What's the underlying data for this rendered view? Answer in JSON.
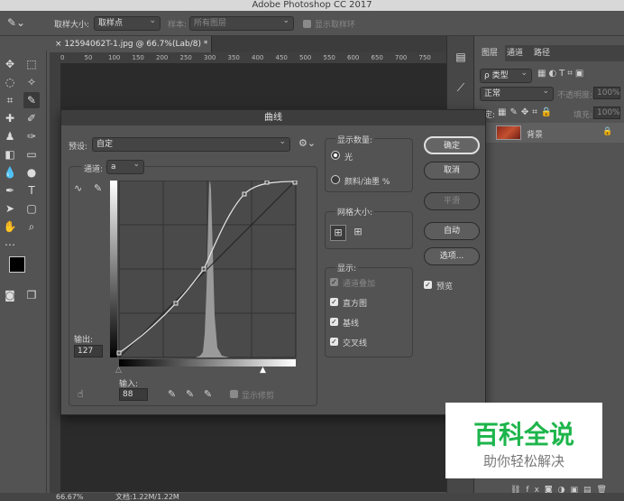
{
  "app": {
    "title": "Adobe Photoshop CC 2017"
  },
  "options_bar": {
    "sample_size_label": "取样大小:",
    "sample_size_value": "取样点",
    "sample_label": "样本:",
    "sample_value": "所有图层",
    "show_ring_label": "显示取样环"
  },
  "document": {
    "tab_title": "12594062T-1.jpg @ 66.7%(Lab/8) *"
  },
  "ruler_ticks": [
    "0",
    "50",
    "100",
    "150",
    "200",
    "250",
    "300",
    "350",
    "400",
    "450",
    "500",
    "550",
    "600",
    "650",
    "700",
    "750"
  ],
  "layers_panel": {
    "tabs": [
      "图层",
      "通道",
      "路径"
    ],
    "kind_label": "ρ 类型",
    "blend_mode": "正常",
    "opacity_label": "不透明度:",
    "opacity_value": "100%",
    "lock_label": "锁定:",
    "fill_label": "填充:",
    "fill_value": "100%",
    "layer_name": "背景"
  },
  "status": {
    "zoom": "66.67%",
    "doc": "文档:1.22M/1.22M"
  },
  "curves_dialog": {
    "title": "曲线",
    "preset_label": "预设:",
    "preset_value": "自定",
    "channel_label": "通道:",
    "channel_value": "a",
    "output_label": "输出:",
    "output_value": "127",
    "input_label": "输入:",
    "input_value": "88",
    "show_clipping_label": "显示修剪",
    "show_amount_title": "显示数量:",
    "light_label": "光",
    "pigment_label": "颜料/油墨 %",
    "grid_size_title": "网格大小:",
    "show_title": "显示:",
    "channel_overlays_label": "通道叠加",
    "histogram_label": "直方图",
    "baseline_label": "基线",
    "intersection_label": "交叉线",
    "ok_label": "确定",
    "cancel_label": "取消",
    "smooth_label": "平滑",
    "auto_label": "自动",
    "options_label": "选项...",
    "preview_label": "预览"
  },
  "watermark": {
    "title": "百科全说",
    "subtitle": "助你轻松解决"
  }
}
